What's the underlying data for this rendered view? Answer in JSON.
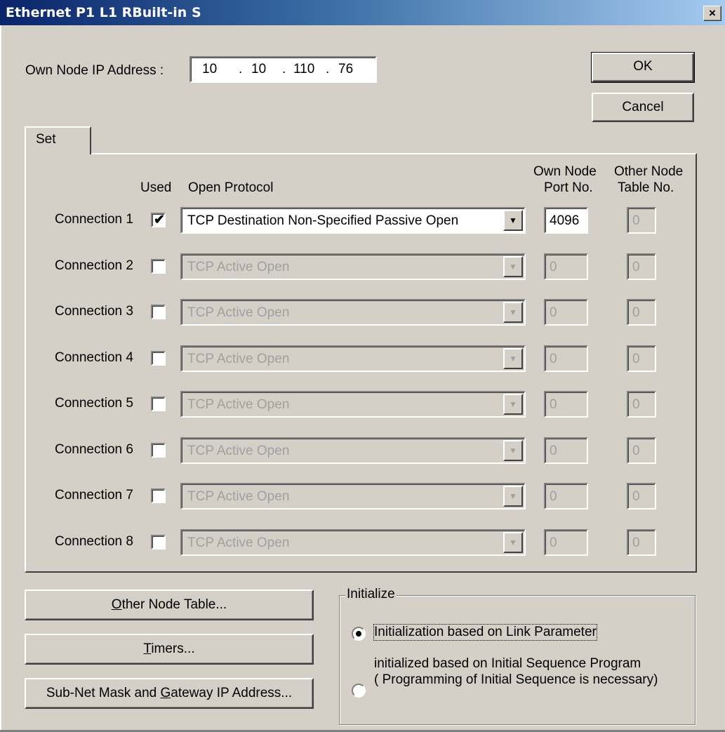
{
  "window": {
    "title": "Ethernet  P1 L1 RBuilt-in S",
    "close_label": "×"
  },
  "ip": {
    "label": "Own Node IP Address :",
    "octets": [
      "10",
      "10",
      "110",
      "76"
    ],
    "dot": "."
  },
  "buttons": {
    "ok": "OK",
    "cancel": "Cancel"
  },
  "tabs": [
    {
      "label": "Set",
      "selected": true
    }
  ],
  "headers": {
    "used": "Used",
    "open_protocol": "Open Protocol",
    "own_port_line1": "Own Node",
    "own_port_line2": "Port No.",
    "other_table_line1": "Other Node",
    "other_table_line2": "Table No."
  },
  "connections": [
    {
      "label": "Connection 1",
      "used": true,
      "protocol": "TCP Destination Non-Specified Passive Open",
      "port": "4096",
      "table": "0"
    },
    {
      "label": "Connection 2",
      "used": false,
      "protocol": "TCP Active Open",
      "port": "0",
      "table": "0"
    },
    {
      "label": "Connection 3",
      "used": false,
      "protocol": "TCP Active Open",
      "port": "0",
      "table": "0"
    },
    {
      "label": "Connection 4",
      "used": false,
      "protocol": "TCP Active Open",
      "port": "0",
      "table": "0"
    },
    {
      "label": "Connection 5",
      "used": false,
      "protocol": "TCP Active Open",
      "port": "0",
      "table": "0"
    },
    {
      "label": "Connection 6",
      "used": false,
      "protocol": "TCP Active Open",
      "port": "0",
      "table": "0"
    },
    {
      "label": "Connection 7",
      "used": false,
      "protocol": "TCP Active Open",
      "port": "0",
      "table": "0"
    },
    {
      "label": "Connection 8",
      "used": false,
      "protocol": "TCP Active Open",
      "port": "0",
      "table": "0"
    }
  ],
  "bottom_buttons": {
    "other_node_table": {
      "accel": "O",
      "rest": "ther Node Table..."
    },
    "timers": {
      "accel": "T",
      "rest": "imers..."
    },
    "subnet": {
      "pre": "Sub-Net Mask and ",
      "accel": "G",
      "rest": "ateway IP Address..."
    }
  },
  "initialize": {
    "title": "Initialize",
    "options": [
      {
        "label": "Initialization based on Link Parameter",
        "selected": true
      },
      {
        "label_line1": "initialized based on Initial Sequence Program",
        "label_line2": "( Programming of Initial Sequence is necessary)",
        "selected": false
      }
    ]
  }
}
